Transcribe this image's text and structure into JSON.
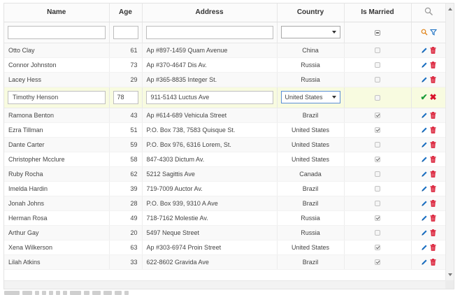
{
  "columns": {
    "name": "Name",
    "age": "Age",
    "address": "Address",
    "country": "Country",
    "married": "Is Married"
  },
  "icons": {
    "search": "search-icon",
    "filter": "filter-icon",
    "edit": "pencil-icon",
    "delete": "trash-icon",
    "accept": "check-icon",
    "cancel": "close-icon"
  },
  "colors": {
    "edit_icon": "#1a6fc2",
    "delete_icon": "#d8112b",
    "accept_icon": "#1a9b3a",
    "edit_row_bg": "#f8fbe0"
  },
  "editing": {
    "name": "Timothy Henson",
    "age": "78",
    "address": "911-5143 Luctus Ave",
    "country": "United States",
    "married": false
  },
  "rows_before": [
    {
      "name": "Otto Clay",
      "age": "61",
      "address": "Ap #897-1459 Quam Avenue",
      "country": "China",
      "married": false
    },
    {
      "name": "Connor Johnston",
      "age": "73",
      "address": "Ap #370-4647 Dis Av.",
      "country": "Russia",
      "married": false
    },
    {
      "name": "Lacey Hess",
      "age": "29",
      "address": "Ap #365-8835 Integer St.",
      "country": "Russia",
      "married": false
    }
  ],
  "rows_after": [
    {
      "name": "Ramona Benton",
      "age": "43",
      "address": "Ap #614-689 Vehicula Street",
      "country": "Brazil",
      "married": true
    },
    {
      "name": "Ezra Tillman",
      "age": "51",
      "address": "P.O. Box 738, 7583 Quisque St.",
      "country": "United States",
      "married": true
    },
    {
      "name": "Dante Carter",
      "age": "59",
      "address": "P.O. Box 976, 6316 Lorem, St.",
      "country": "United States",
      "married": false
    },
    {
      "name": "Christopher Mcclure",
      "age": "58",
      "address": "847-4303 Dictum Av.",
      "country": "United States",
      "married": true
    },
    {
      "name": "Ruby Rocha",
      "age": "62",
      "address": "5212 Sagittis Ave",
      "country": "Canada",
      "married": false
    },
    {
      "name": "Imelda Hardin",
      "age": "39",
      "address": "719-7009 Auctor Av.",
      "country": "Brazil",
      "married": false
    },
    {
      "name": "Jonah Johns",
      "age": "28",
      "address": "P.O. Box 939, 9310 A Ave",
      "country": "Brazil",
      "married": false
    },
    {
      "name": "Herman Rosa",
      "age": "49",
      "address": "718-7162 Molestie Av.",
      "country": "Russia",
      "married": true
    },
    {
      "name": "Arthur Gay",
      "age": "20",
      "address": "5497 Neque Street",
      "country": "Russia",
      "married": false
    },
    {
      "name": "Xena Wilkerson",
      "age": "63",
      "address": "Ap #303-6974 Proin Street",
      "country": "United States",
      "married": true
    },
    {
      "name": "Lilah Atkins",
      "age": "33",
      "address": "622-8602 Gravida Ave",
      "country": "Brazil",
      "married": true
    }
  ]
}
